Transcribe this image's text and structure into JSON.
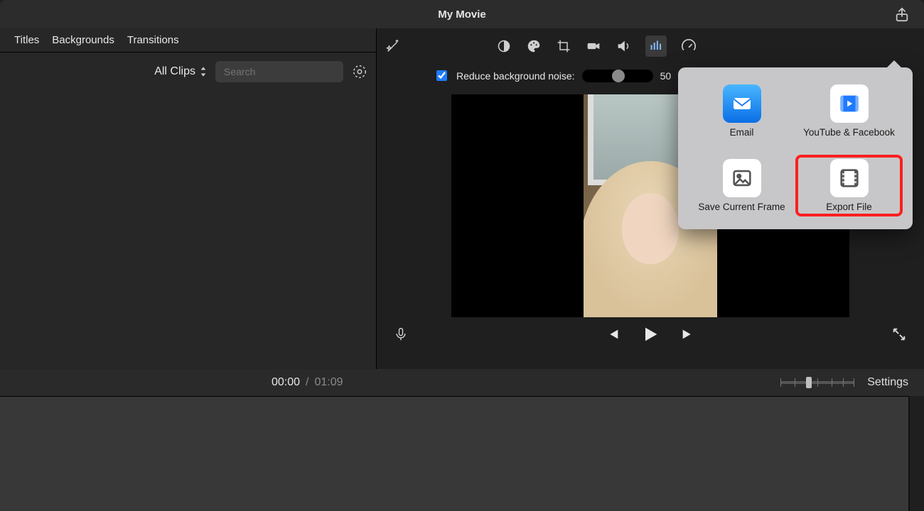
{
  "window": {
    "title": "My Movie"
  },
  "browser": {
    "tabs": [
      "Titles",
      "Backgrounds",
      "Transitions"
    ],
    "clips_filter": "All Clips",
    "search_placeholder": "Search"
  },
  "inspector": {
    "noise_reduce_label": "Reduce background noise:",
    "noise_reduce_checked": true,
    "noise_reduce_value": "50",
    "noise_reduce_unit": "%"
  },
  "playback": {
    "current_time": "00:00",
    "separator": "/",
    "duration": "01:09"
  },
  "timeline": {
    "settings_label": "Settings"
  },
  "share_popover": {
    "items": [
      {
        "id": "email",
        "label": "Email"
      },
      {
        "id": "youtube-facebook",
        "label": "YouTube & Facebook"
      },
      {
        "id": "save-current-frame",
        "label": "Save Current Frame"
      },
      {
        "id": "export-file",
        "label": "Export File",
        "highlighted": true
      }
    ]
  },
  "icons": {
    "share": "share-icon",
    "magic": "magic-wand-icon",
    "contrast": "contrast-icon",
    "color": "palette-icon",
    "crop": "crop-icon",
    "camera": "camera-icon",
    "audio": "speaker-icon",
    "eq": "equalizer-icon",
    "speed": "speedometer-icon",
    "search": "search-icon",
    "gear": "gear-icon",
    "mic": "mic-icon",
    "prev": "skip-back-icon",
    "play": "play-icon",
    "next": "skip-forward-icon",
    "fullscreen": "fullscreen-icon",
    "sort": "sort-arrows-icon"
  }
}
